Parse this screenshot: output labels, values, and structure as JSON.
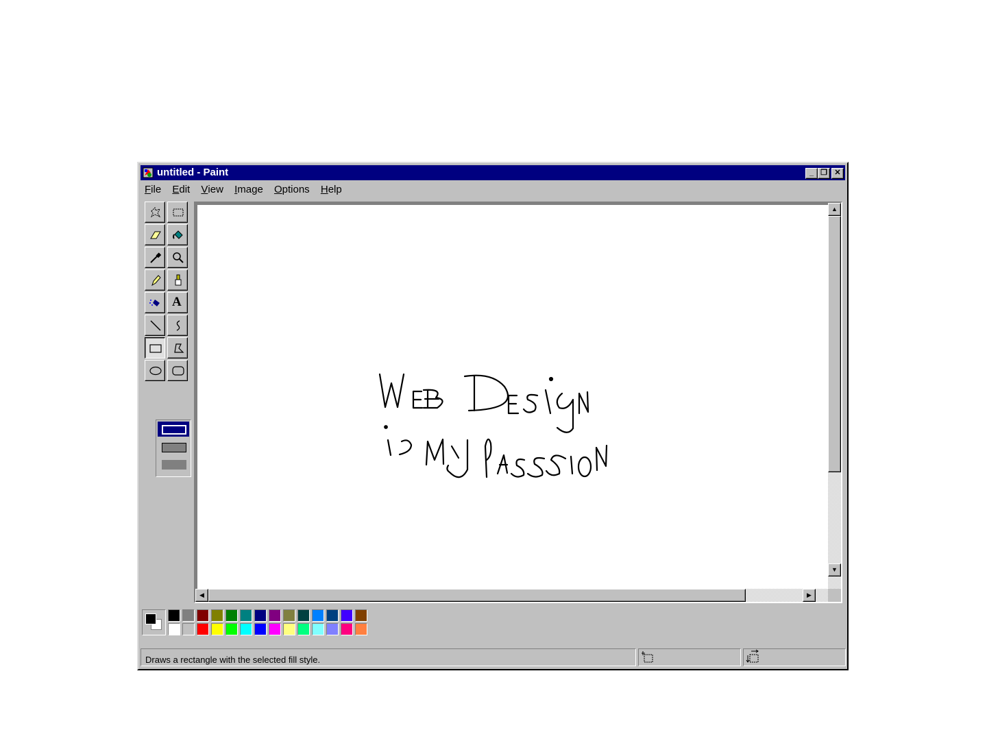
{
  "window": {
    "title": "untitled - Paint",
    "title_buttons": [
      "_",
      "❐",
      "✕"
    ]
  },
  "menu": [
    {
      "label": "File",
      "accel": "F",
      "rest": "ile"
    },
    {
      "label": "Edit",
      "accel": "E",
      "rest": "dit"
    },
    {
      "label": "View",
      "accel": "V",
      "rest": "iew"
    },
    {
      "label": "Image",
      "accel": "I",
      "rest": "mage"
    },
    {
      "label": "Options",
      "accel": "O",
      "rest": "ptions"
    },
    {
      "label": "Help",
      "accel": "H",
      "rest": "elp"
    }
  ],
  "tools": [
    "free-form-select-icon",
    "rect-select-icon",
    "eraser-icon",
    "fill-bucket-icon",
    "color-picker-icon",
    "magnifier-icon",
    "pencil-icon",
    "brush-icon",
    "airbrush-icon",
    "text-icon",
    "line-icon",
    "curve-icon",
    "rectangle-icon",
    "polygon-icon",
    "ellipse-icon",
    "rounded-rect-icon"
  ],
  "selected_tool": "rectangle-icon",
  "text_tool_glyph": "A",
  "canvas_text": [
    "Web Design",
    "is My Passion"
  ],
  "colors": {
    "foreground": "#000000",
    "background": "#ffffff",
    "title_bar": "#000080",
    "row1": [
      "#000000",
      "#808080",
      "#800000",
      "#808000",
      "#008000",
      "#008080",
      "#000080",
      "#800080",
      "#808040",
      "#004040",
      "#0080ff",
      "#004080",
      "#4000ff",
      "#804000"
    ],
    "row2": [
      "#ffffff",
      "#c0c0c0",
      "#ff0000",
      "#ffff00",
      "#00ff00",
      "#00ffff",
      "#0000ff",
      "#ff00ff",
      "#ffff80",
      "#00ff80",
      "#80ffff",
      "#8080ff",
      "#ff0080",
      "#ff8040"
    ]
  },
  "status": {
    "message": "Draws a rectangle with the selected fill style.",
    "position_icon": "cursor-position-icon",
    "size_icon": "selection-size-icon"
  }
}
